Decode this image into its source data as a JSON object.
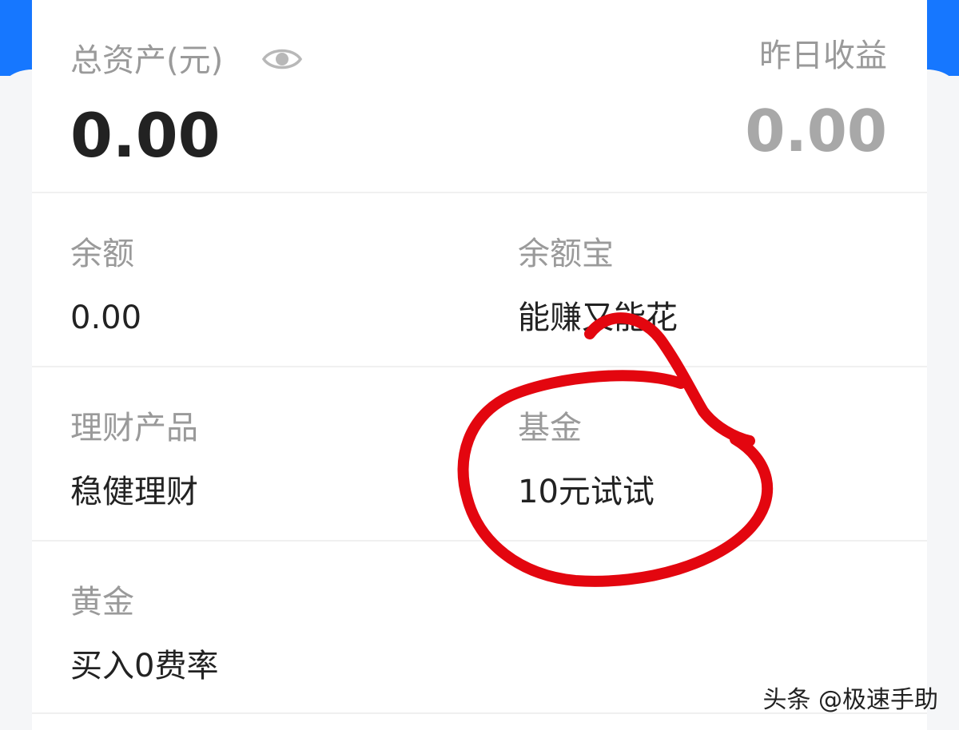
{
  "summary": {
    "total_assets_label": "总资产(元)",
    "total_assets_value": "0.00",
    "yesterday_earnings_label": "昨日收益",
    "yesterday_earnings_value": "0.00"
  },
  "items": [
    {
      "label": "余额",
      "value": "0.00"
    },
    {
      "label": "余额宝",
      "value": "能赚又能花"
    },
    {
      "label": "理财产品",
      "value": "稳健理财"
    },
    {
      "label": "基金",
      "value": "10元试试"
    },
    {
      "label": "黄金",
      "value": "买入0费率"
    }
  ],
  "watermark": "头条 @极速手助",
  "colors": {
    "accent_blue": "#1677ff",
    "annotation_red": "#e3060f",
    "label_gray": "#9a9a9a",
    "text_dark": "#222222"
  },
  "icons": {
    "visibility": "eye-icon"
  }
}
